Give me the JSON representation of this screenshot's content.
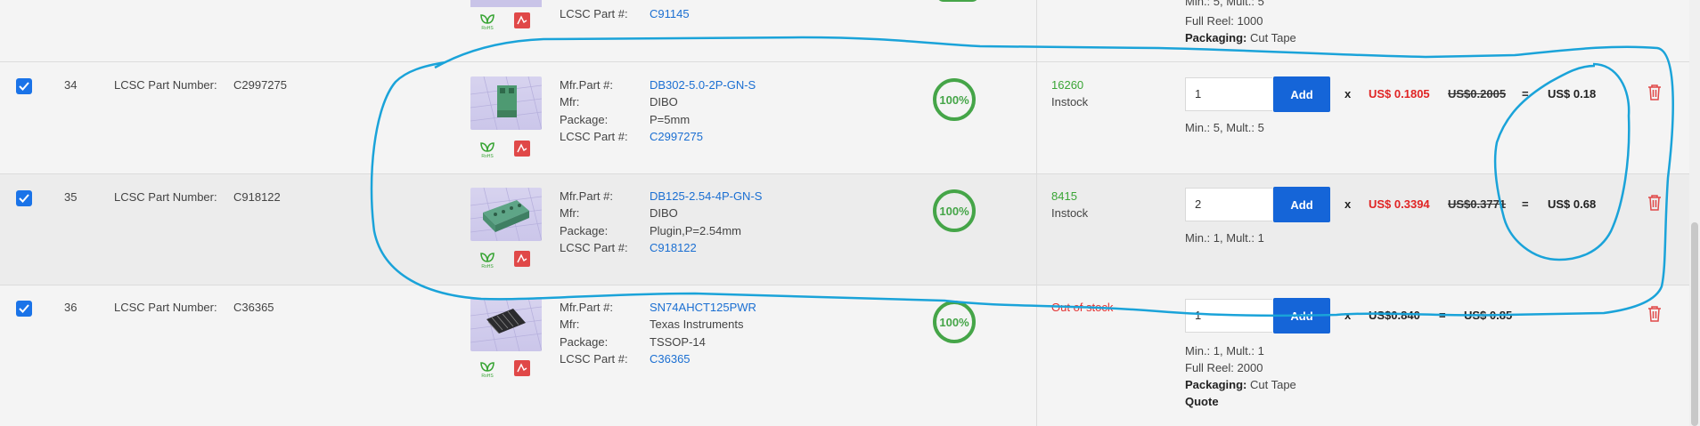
{
  "top_partial": {
    "lcsc_label": "LCSC Part #:",
    "lcsc_value": "C91145",
    "min_mult": "Min.: 5, Mult.: 5",
    "full_reel": "Full Reel: 1000",
    "packaging_label": "Packaging:",
    "packaging_value": "Cut Tape"
  },
  "labels": {
    "lcsc_part_number": "LCSC Part Number:",
    "mfr_part": "Mfr.Part #:",
    "mfr": "Mfr:",
    "package": "Package:",
    "lcsc_part": "LCSC Part #:",
    "add": "Add",
    "x": "x",
    "eq": "=",
    "packaging": "Packaging:"
  },
  "rows": [
    {
      "index": "34",
      "lcsc": "C2997275",
      "mfr_part": "DB302-5.0-2P-GN-S",
      "mfr": "DIBO",
      "package": "P=5mm",
      "lcsc_link": "C2997275",
      "match": "100%",
      "stock_qty": "16260",
      "stock_status": "Instock",
      "qty": "1",
      "unit_price": "US$ 0.1805",
      "old_price": "US$0.2005",
      "total": "US$ 0.18",
      "min_mult": "Min.: 5, Mult.: 5"
    },
    {
      "index": "35",
      "lcsc": "C918122",
      "mfr_part": "DB125-2.54-4P-GN-S",
      "mfr": "DIBO",
      "package": "Plugin,P=2.54mm",
      "lcsc_link": "C918122",
      "match": "100%",
      "stock_qty": "8415",
      "stock_status": "Instock",
      "qty": "2",
      "unit_price": "US$ 0.3394",
      "old_price": "US$0.3771",
      "total": "US$ 0.68",
      "min_mult": "Min.: 1, Mult.: 1"
    },
    {
      "index": "36",
      "lcsc": "C36365",
      "mfr_part": "SN74AHCT125PWR",
      "mfr": "Texas Instruments",
      "package": "TSSOP-14",
      "lcsc_link": "C36365",
      "match": "100%",
      "stock_status": "Out of stock",
      "qty": "1",
      "unit_price": "US$0.840",
      "total": "US$ 0.85",
      "min_mult": "Min.: 1, Mult.: 1",
      "full_reel": "Full Reel: 2000",
      "packaging_value": "Cut Tape",
      "quote": "Quote"
    }
  ],
  "icons": {
    "rohs": "rohs-leaf-icon",
    "pdf": "pdf-icon",
    "delete": "trash-icon",
    "checkbox": "checkbox-checked-icon"
  },
  "colors": {
    "accent_blue": "#1565d8",
    "link_blue": "#1b6fd2",
    "stock_green": "#3aa536",
    "price_red": "#e02424",
    "quote_orange": "#f39a1b",
    "annotation_cyan": "#1aa3d9"
  }
}
